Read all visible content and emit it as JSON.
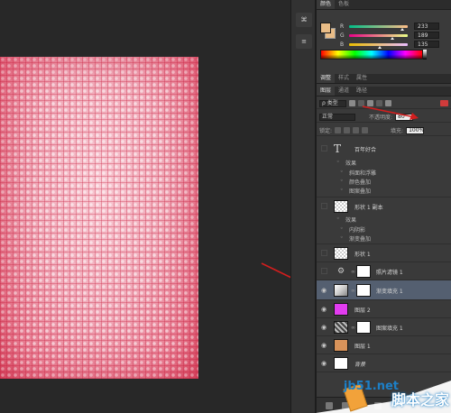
{
  "color_panel": {
    "tabs": [
      "颜色",
      "色板"
    ],
    "channels": [
      {
        "label": "R",
        "value": "233",
        "level": 0.91,
        "gradient": "linear-gradient(to right, #00bd87, #ffbd87)"
      },
      {
        "label": "G",
        "value": "189",
        "level": 0.74,
        "gradient": "linear-gradient(to right, #e90087, #e9ff87)"
      },
      {
        "label": "B",
        "value": "135",
        "level": 0.53,
        "gradient": "linear-gradient(to right, #e9bd00, #e9bdff)"
      }
    ],
    "foreground": "#e9bd87"
  },
  "styles_tabs": [
    "调整",
    "样式",
    "属性"
  ],
  "layers_panel": {
    "tabs": [
      "图层",
      "通道",
      "路径"
    ],
    "kind_filter": "ρ 类型",
    "blend_mode": "正常",
    "opacity_label": "不透明度:",
    "opacity_value": "80",
    "lock_label": "锁定:",
    "fill_label": "填充:",
    "fill_value": "100%"
  },
  "layers": [
    {
      "name": "百年好合",
      "type": "text",
      "visible": false,
      "effects_label": "效果",
      "effects": [
        "斜面和浮雕",
        "颜色叠加",
        "图案叠加"
      ]
    },
    {
      "name": "形状 1 副本",
      "type": "shape",
      "visible": false,
      "effects_label": "效果",
      "effects": [
        "内阴影",
        "渐变叠加"
      ]
    },
    {
      "name": "形状 1",
      "type": "shape",
      "visible": false
    },
    {
      "name": "照片滤镜 1",
      "type": "adjustment",
      "visible": false
    },
    {
      "name": "渐变填充 1",
      "type": "gradient",
      "visible": true,
      "selected": true
    },
    {
      "name": "图层 2",
      "type": "pixel",
      "visible": true,
      "color": "#e23cf0"
    },
    {
      "name": "图案填充 1",
      "type": "pattern",
      "visible": true
    },
    {
      "name": "图层 1",
      "type": "pixel",
      "visible": true,
      "color": "#d9935a"
    },
    {
      "name": "背景",
      "type": "background",
      "visible": true,
      "color": "#ffffff"
    }
  ],
  "watermark": {
    "site": "jb51.net",
    "brand": "脚本之家"
  },
  "icons": [
    "eye-icon",
    "link-icon",
    "text-layer-icon",
    "adjustment-layer-icon"
  ]
}
